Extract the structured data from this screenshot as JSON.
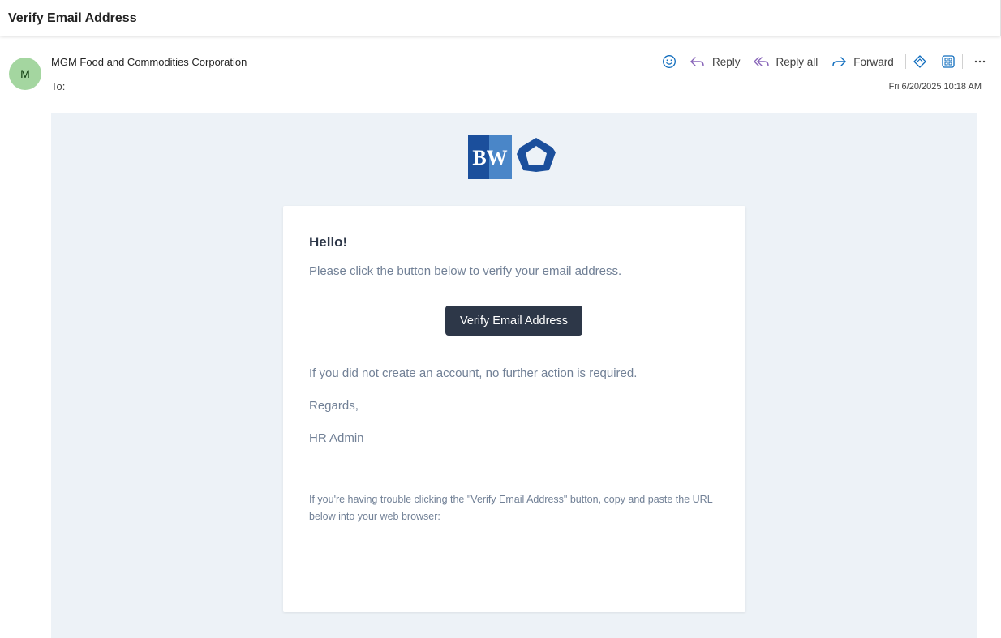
{
  "subject": "Verify Email Address",
  "sender": {
    "avatar_initial": "M",
    "name": "MGM Food and Commodities Corporation",
    "to_label": "To:"
  },
  "actions": {
    "emoji_icon": "smiley-icon",
    "reply": "Reply",
    "reply_all": "Reply all",
    "forward": "Forward",
    "more_icon": "ellipsis-icon"
  },
  "timestamp": "Fri 6/20/2025 10:18 AM",
  "colors": {
    "accent": "#0f6cbd",
    "reply_purple": "#8764b8",
    "avatar_bg": "#a4d6a0",
    "email_bg": "#edf2f7",
    "button_bg": "#2d3748",
    "logo_dark_blue": "#1b4f9c",
    "logo_light_blue": "#4a86c8"
  },
  "email": {
    "logo_text": "BW",
    "greeting": "Hello!",
    "intro": "Please click the button below to verify your email address.",
    "button_label": "Verify Email Address",
    "no_action": "If you did not create an account, no further action is required.",
    "regards": "Regards,",
    "signature": "HR Admin",
    "trouble_text": "If you're having trouble clicking the \"Verify Email Address\" button, copy and paste the URL below into your web browser:"
  }
}
